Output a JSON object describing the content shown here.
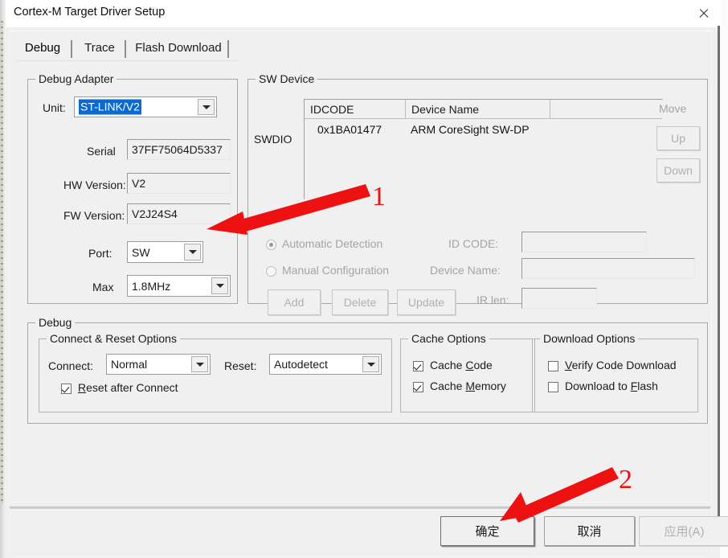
{
  "window": {
    "title": "Cortex-M Target Driver Setup",
    "close_icon": "close-icon"
  },
  "tabs": [
    {
      "label": "Debug",
      "selected": true
    },
    {
      "label": "Trace",
      "selected": false
    },
    {
      "label": "Flash Download",
      "selected": false
    }
  ],
  "debug_adapter": {
    "group_title": "Debug Adapter",
    "unit_label": "Unit:",
    "unit_value": "ST-LINK/V2",
    "serial_label": "Serial",
    "serial_value": "37FF75064D5337",
    "hw_version_label": "HW Version:",
    "hw_version_value": "V2",
    "fw_version_label": "FW Version:",
    "fw_version_value": "V2J24S4",
    "port_label": "Port:",
    "port_value": "SW",
    "max_label": "Max",
    "max_value": "1.8MHz"
  },
  "sw_device": {
    "group_title": "SW Device",
    "bus_label": "SWDIO",
    "columns": [
      "IDCODE",
      "Device Name",
      ""
    ],
    "rows": [
      {
        "idcode": "0x1BA01477",
        "device_name": "ARM CoreSight SW-DP",
        "extra": ""
      }
    ],
    "move_label": "Move",
    "up_button": "Up",
    "down_button": "Down",
    "automatic_detection": "Automatic Detection",
    "manual_configuration": "Manual Configuration",
    "auto_selected": true,
    "id_code_label": "ID CODE:",
    "id_code_value": "",
    "device_name_label": "Device Name:",
    "device_name_value": "",
    "ir_len_label": "IR len:",
    "ir_len_value": "",
    "add_button": "Add",
    "delete_button": "Delete",
    "update_button": "Update"
  },
  "debug": {
    "group_title": "Debug",
    "connect_reset": {
      "group_title": "Connect & Reset Options",
      "connect_label": "Connect:",
      "connect_value": "Normal",
      "reset_label": "Reset:",
      "reset_value": "Autodetect",
      "reset_after_connect_label": "Reset after Connect",
      "reset_after_connect_checked": true
    },
    "cache_options": {
      "group_title": "Cache Options",
      "cache_code_label": "Cache Code",
      "cache_code_checked": true,
      "cache_memory_label": "Cache Memory",
      "cache_memory_checked": true
    },
    "download_options": {
      "group_title": "Download Options",
      "verify_code_download_label": "Verify Code Download",
      "verify_code_download_checked": false,
      "download_to_flash_label": "Download to Flash",
      "download_to_flash_checked": false
    }
  },
  "footer": {
    "ok_button": "确定",
    "cancel_button": "取消",
    "apply_button": "应用(A)",
    "apply_disabled": true
  },
  "annotations": [
    {
      "number": "1",
      "color": "#ee1111"
    },
    {
      "number": "2",
      "color": "#ee1111"
    }
  ]
}
